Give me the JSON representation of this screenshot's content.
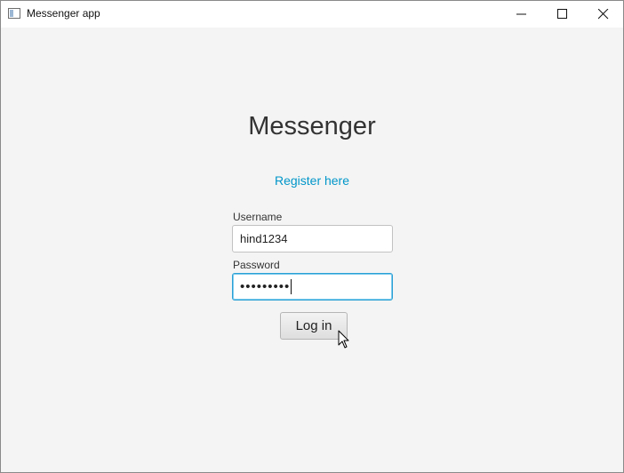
{
  "window": {
    "title": "Messenger app",
    "controls": [
      "minimize-icon",
      "maximize-icon",
      "close-icon"
    ]
  },
  "main": {
    "heading": "Messenger",
    "register_link": "Register here",
    "username": {
      "label": "Username",
      "value": "hind1234"
    },
    "password": {
      "label": "Password",
      "masked_value": "•••••••••"
    },
    "login_button": "Log in"
  },
  "colors": {
    "background": "#f4f4f4",
    "link": "#0096c9",
    "focus_border": "#2aa0d4",
    "text": "#333333"
  }
}
